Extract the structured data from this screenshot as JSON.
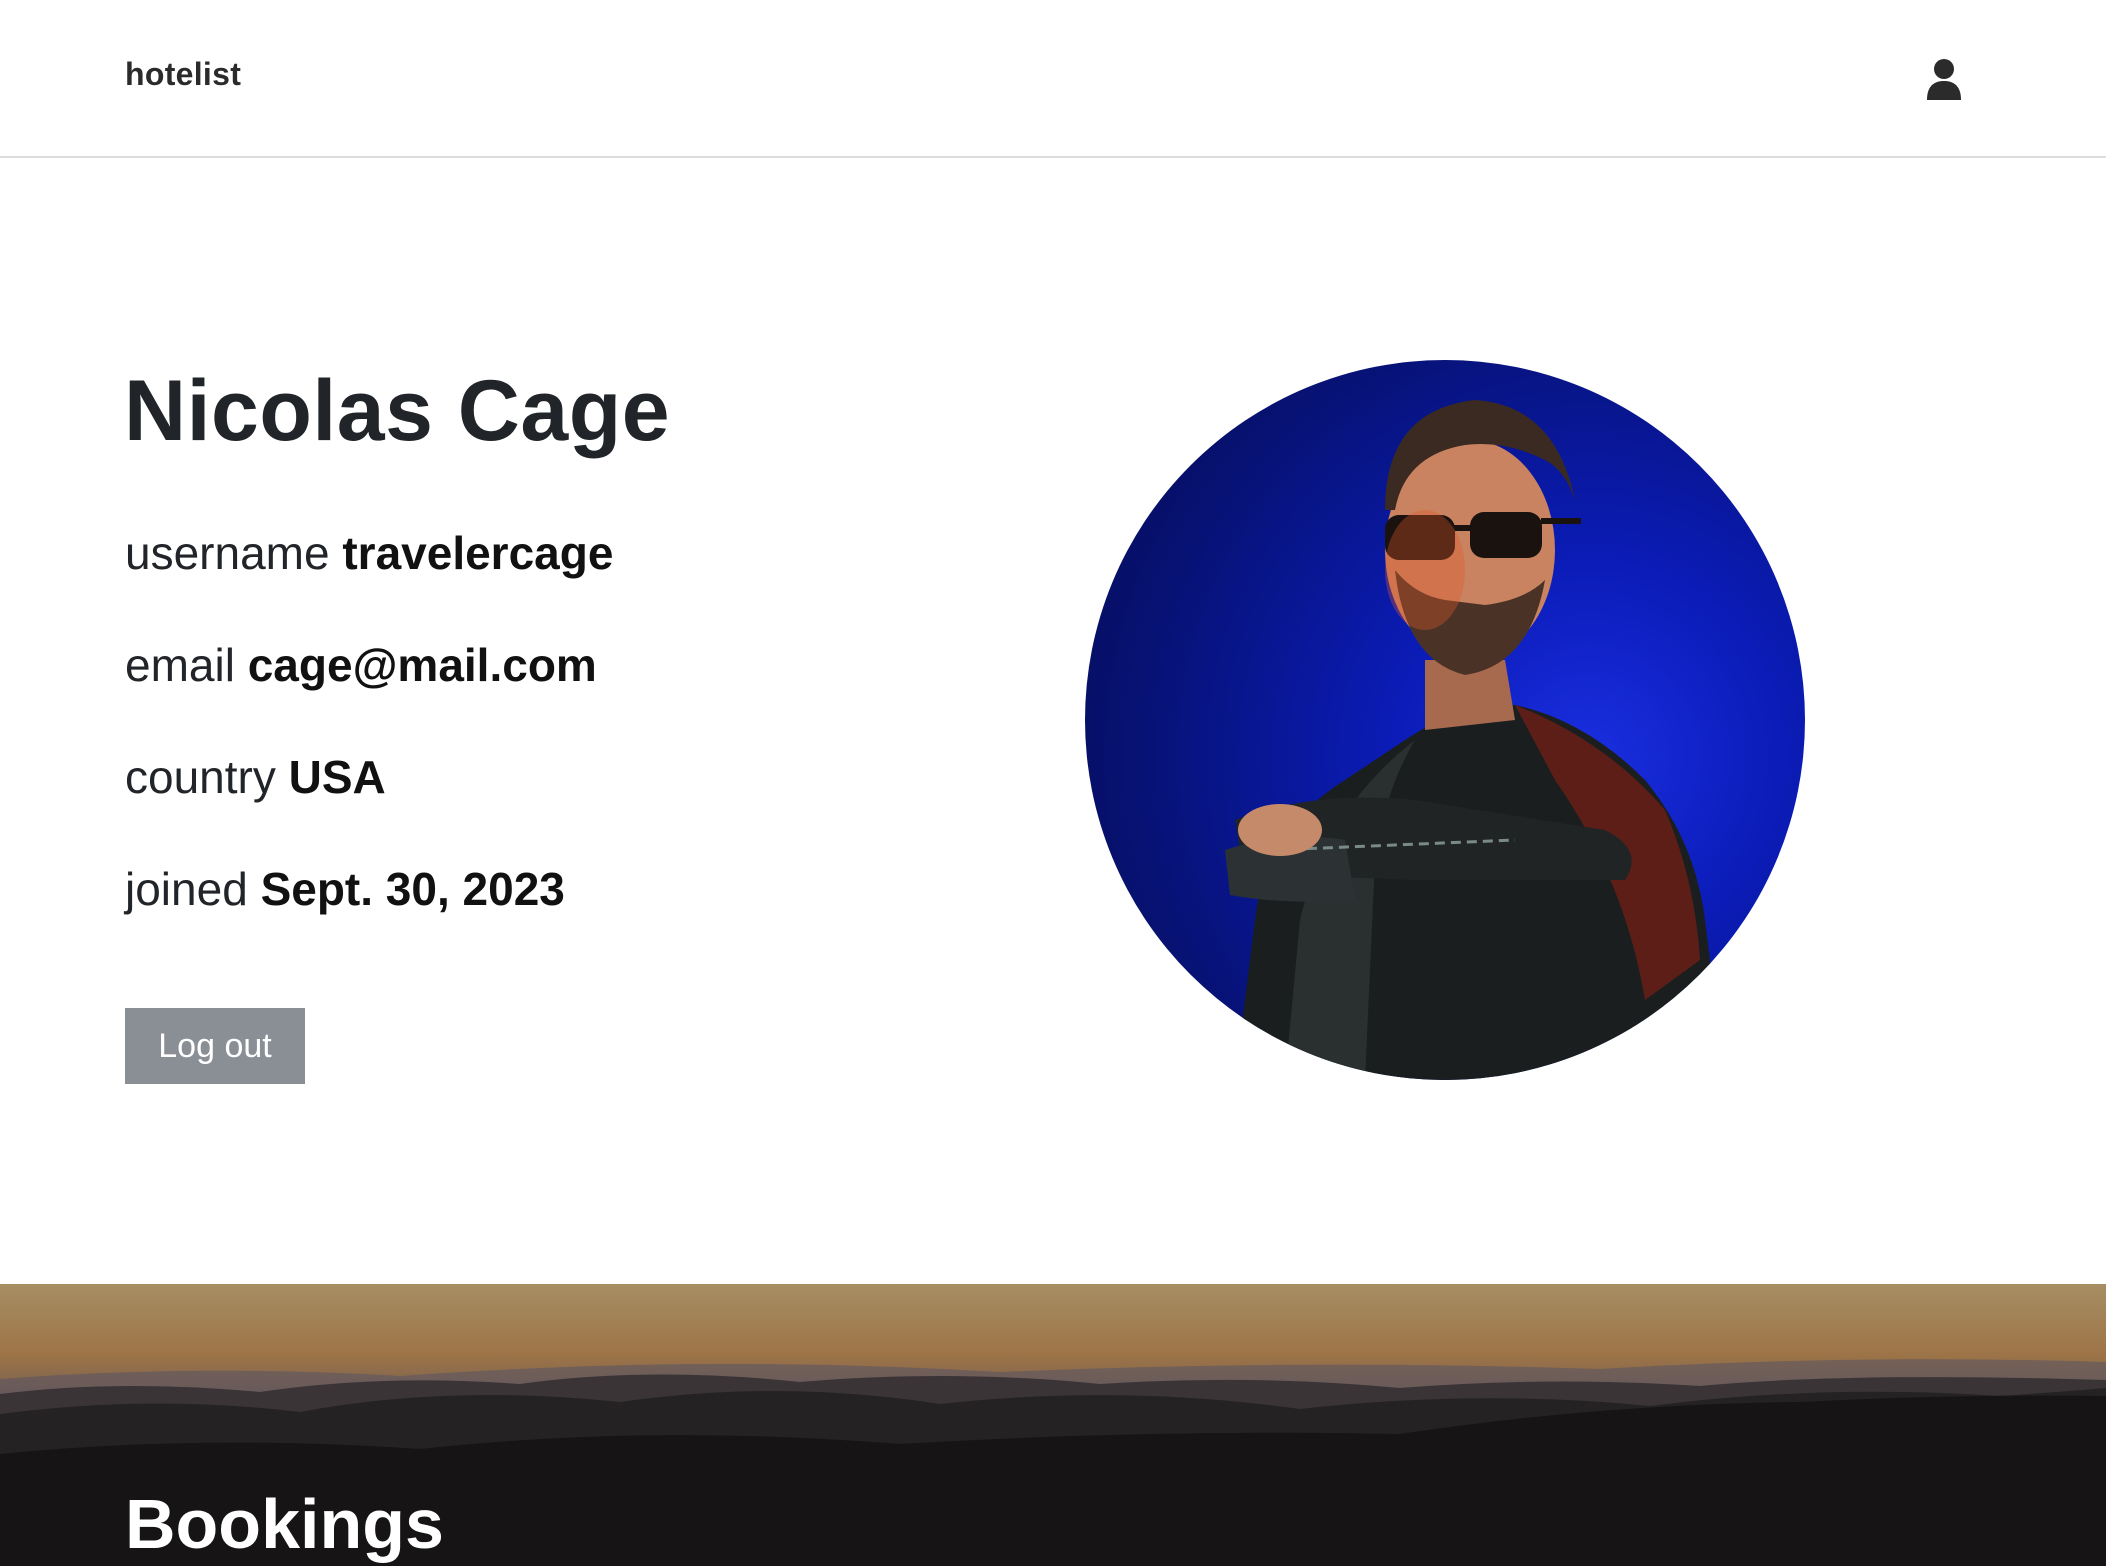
{
  "navbar": {
    "brand": "hotelist",
    "user_icon": "user-icon"
  },
  "profile": {
    "name": "Nicolas Cage",
    "fields": [
      {
        "label": "username",
        "value": "travelercage"
      },
      {
        "label": "email",
        "value": "cage@mail.com"
      },
      {
        "label": "country",
        "value": "USA"
      },
      {
        "label": "joined",
        "value": "Sept. 30, 2023"
      }
    ],
    "logout_label": "Log out",
    "avatar_description": "profile-photo"
  },
  "bookings": {
    "title": "Bookings"
  },
  "colors": {
    "button_bg": "#8a8f96",
    "avatar_bg": "#0b1cb8",
    "text": "#212529"
  }
}
